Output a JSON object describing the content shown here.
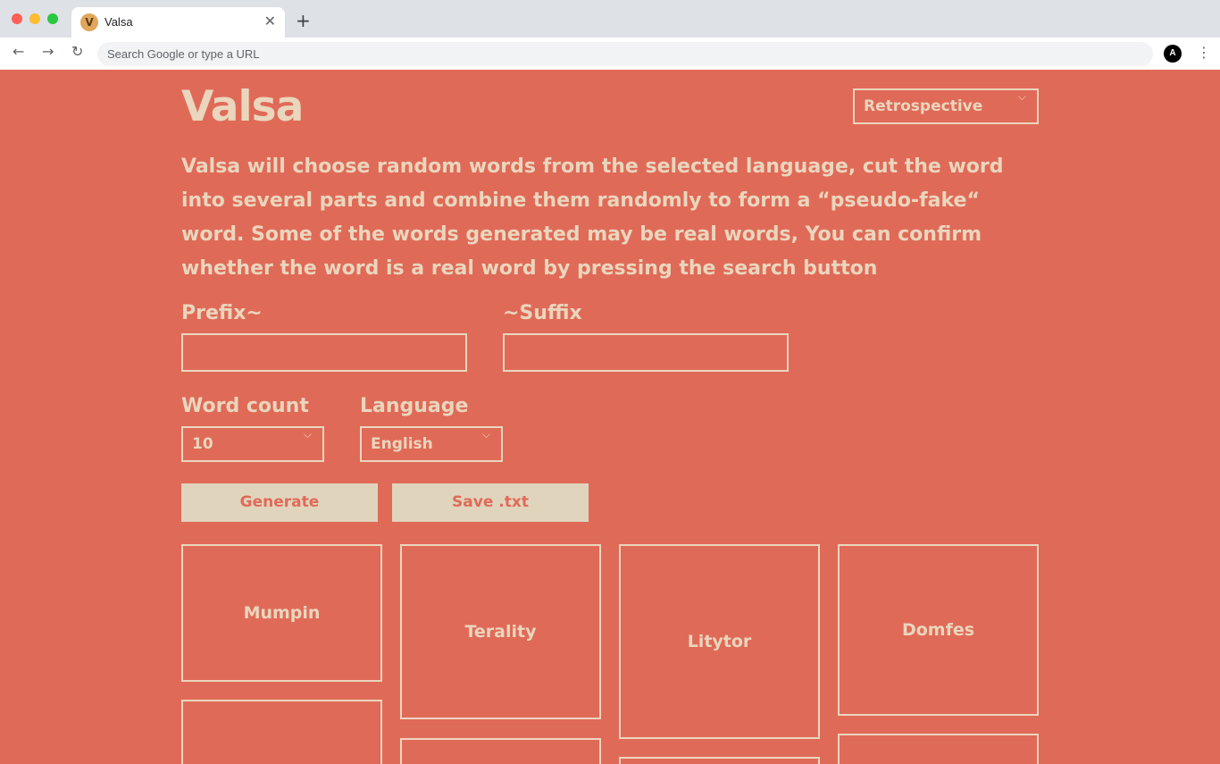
{
  "browser": {
    "tab_title": "Valsa",
    "favicon_letter": "V",
    "close_glyph": "✕",
    "newtab_glyph": "+",
    "back_glyph": "←",
    "forward_glyph": "→",
    "reload_glyph": "↻",
    "omnibox_placeholder": "Search Google or type a URL",
    "profile_initial": "A",
    "menu_glyph": "⋮"
  },
  "header": {
    "title": "Valsa",
    "theme_selected": "Retrospective"
  },
  "description": "Valsa will choose random words from the selected language, cut the word into several parts and combine them randomly to form a “pseudo-fake“ word. Some of the words generated may be real words, You can confirm whether the word is a real word by pressing the search button",
  "form": {
    "prefix_label": "Prefix~",
    "prefix_value": "",
    "suffix_label": "~Suffix",
    "suffix_value": "",
    "word_count_label": "Word count",
    "word_count_value": "10",
    "language_label": "Language",
    "language_value": "English",
    "generate_label": "Generate",
    "save_label": "Save .txt"
  },
  "chevron_glyph": "⌵",
  "words": [
    "Mumpin",
    "Terality",
    "Litytor",
    "Domfes",
    "",
    "",
    "",
    ""
  ],
  "colors": {
    "background": "#e06a58",
    "foreground": "#ead6bd",
    "button_bg": "#e1d4bd"
  }
}
